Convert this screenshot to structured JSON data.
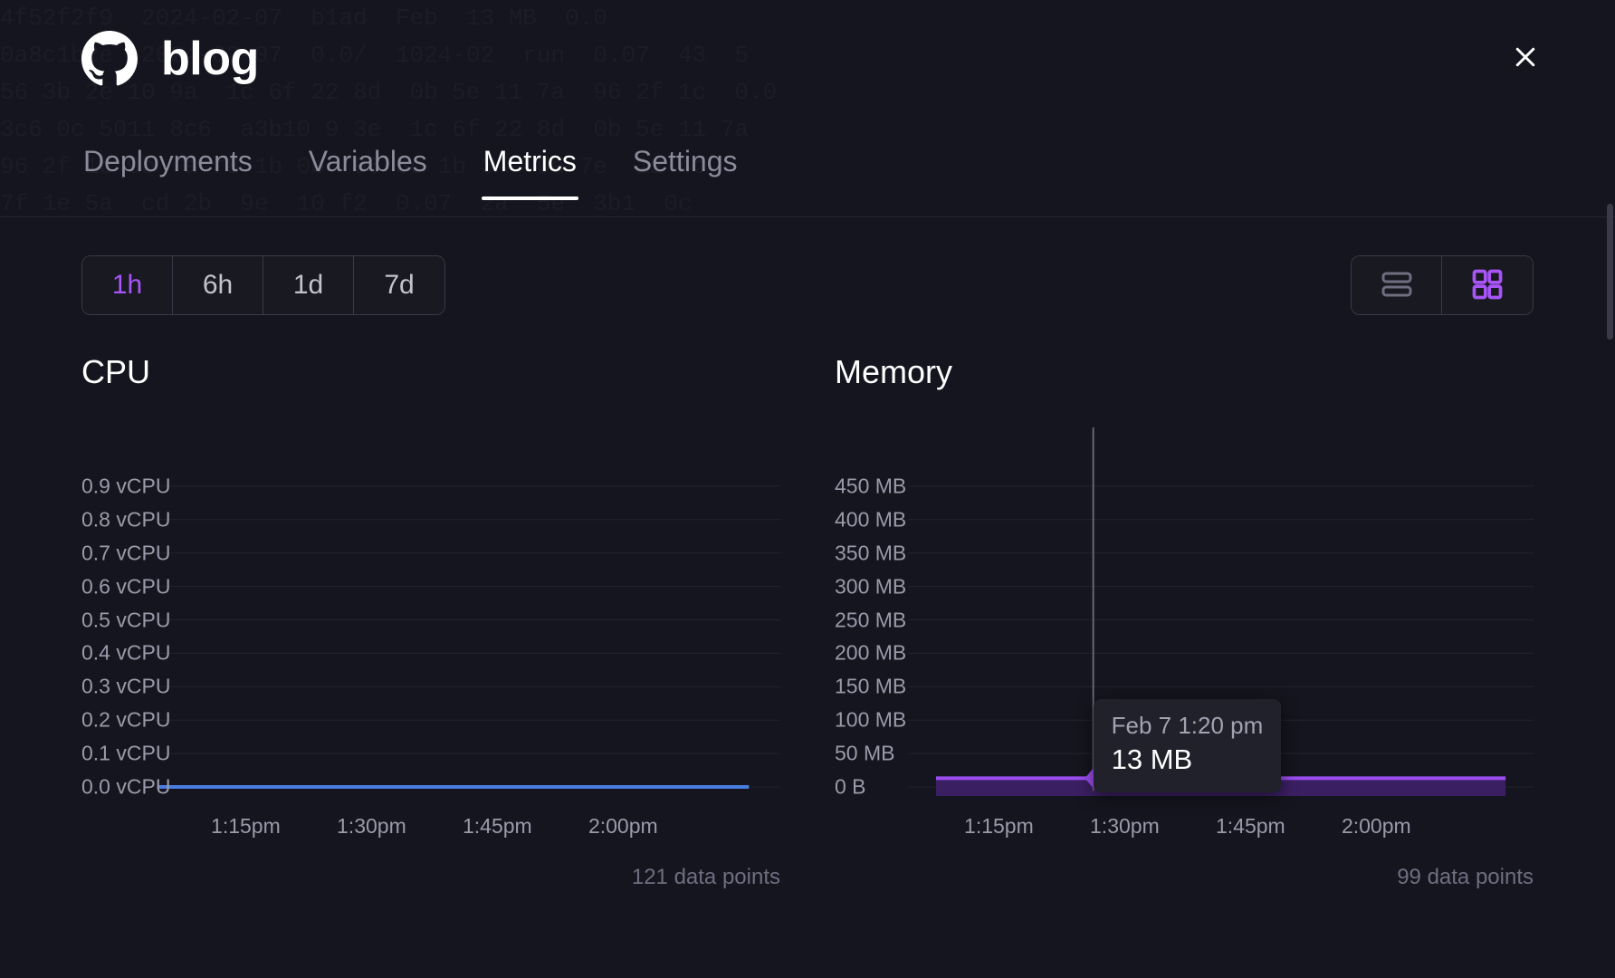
{
  "header": {
    "title": "blog",
    "logo_icon": "github-logo-icon",
    "close_icon": "close-icon",
    "close_label": "Close"
  },
  "tabs": [
    {
      "label": "Deployments",
      "active": false
    },
    {
      "label": "Variables",
      "active": false
    },
    {
      "label": "Metrics",
      "active": true
    },
    {
      "label": "Settings",
      "active": false
    }
  ],
  "time_range": {
    "options": [
      "1h",
      "6h",
      "1d",
      "7d"
    ],
    "selected": "1h",
    "active_color": "#a855f7",
    "inactive_color": "#c3c3ce"
  },
  "view_toggle": {
    "options": [
      {
        "icon": "list-view-icon",
        "active": false
      },
      {
        "icon": "grid-view-icon",
        "active": true
      }
    ],
    "active_color": "#a855f7",
    "inactive_color": "#6e6e80"
  },
  "tooltip": {
    "time": "Feb 7 1:20 pm",
    "value": "13 MB"
  },
  "chart_data": [
    {
      "type": "line",
      "title": "CPU",
      "xlabel": "",
      "ylabel": "vCPU",
      "ylim": [
        0,
        1.0
      ],
      "grid": true,
      "legend": "none",
      "series_color": "#4a7de0",
      "footer": "121 data points",
      "data_points": 121,
      "ytick_labels": [
        "0.9 vCPU",
        "0.8 vCPU",
        "0.7 vCPU",
        "0.6 vCPU",
        "0.5 vCPU",
        "0.4 vCPU",
        "0.3 vCPU",
        "0.2 vCPU",
        "0.1 vCPU",
        "0.0 vCPU"
      ],
      "ytick_values": [
        0.9,
        0.8,
        0.7,
        0.6,
        0.5,
        0.4,
        0.3,
        0.2,
        0.1,
        0.0
      ],
      "xtick_labels": [
        "1:15pm",
        "1:30pm",
        "1:45pm",
        "2:00pm"
      ],
      "xtick_positions": [
        0.235,
        0.415,
        0.595,
        0.775
      ],
      "series": [
        {
          "name": "CPU",
          "values": [
            0.0,
            0.0,
            0.0,
            0.0,
            0.0,
            0.0,
            0.0,
            0.0,
            0.0,
            0.0,
            0.0,
            0.0,
            0.0,
            0.0,
            0.0,
            0.0,
            0.0,
            0.0,
            0.0,
            0.0,
            0.0
          ]
        }
      ],
      "series_x_start": 0.11,
      "series_x_end": 0.955
    },
    {
      "type": "area",
      "title": "Memory",
      "xlabel": "",
      "ylabel": "MB",
      "ylim": [
        0,
        500
      ],
      "grid": true,
      "legend": "none",
      "series_color": "#9b4df0",
      "fill_color": "#3b1f63",
      "footer": "99 data points",
      "data_points": 99,
      "ytick_labels": [
        "450 MB",
        "400 MB",
        "350 MB",
        "300 MB",
        "250 MB",
        "200 MB",
        "150 MB",
        "100 MB",
        "50 MB",
        "0 B"
      ],
      "ytick_values": [
        450,
        400,
        350,
        300,
        250,
        200,
        150,
        100,
        50,
        0
      ],
      "xtick_labels": [
        "1:15pm",
        "1:30pm",
        "1:45pm",
        "2:00pm"
      ],
      "xtick_positions": [
        0.235,
        0.415,
        0.595,
        0.775
      ],
      "series": [
        {
          "name": "Memory",
          "values": [
            13,
            13,
            13,
            13,
            13,
            13,
            13,
            13,
            13,
            13,
            13,
            13,
            13,
            13,
            13,
            13,
            13,
            13,
            13,
            13,
            13
          ]
        }
      ],
      "series_x_start": 0.145,
      "series_x_end": 0.96,
      "marker": {
        "x_ratio": 0.37,
        "value": 13,
        "label": "13 MB"
      }
    }
  ]
}
